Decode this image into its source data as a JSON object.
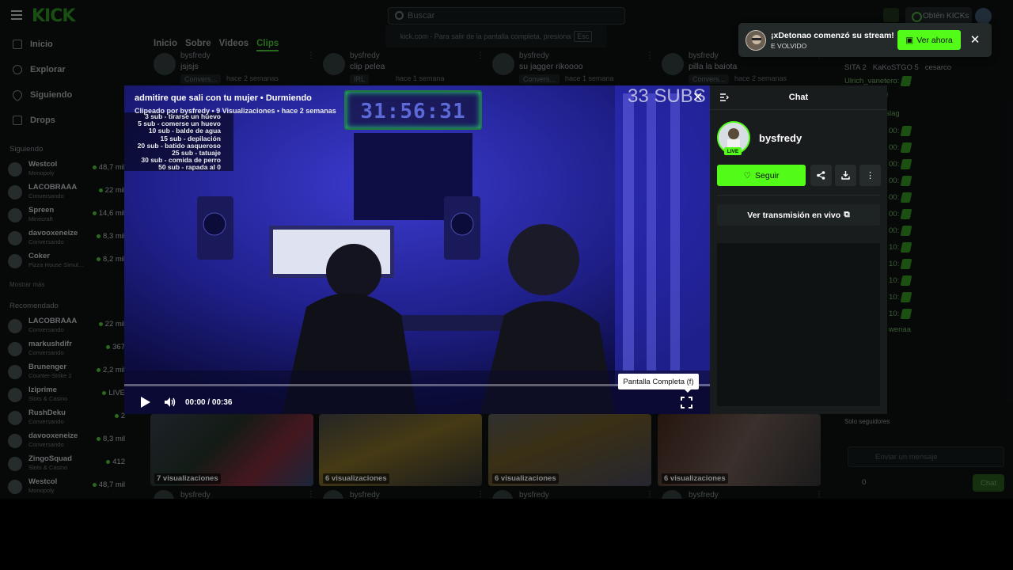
{
  "topbar": {
    "logo": "KICK",
    "search_placeholder": "Buscar",
    "fullscreen_hint": "kick.com - Para salir de la pantalla completa, presiona",
    "fullscreen_key": "Esc",
    "get_kicks": "Obtén KICKs"
  },
  "sidebar": {
    "nav": [
      {
        "label": "Inicio",
        "icon": "home-icon"
      },
      {
        "label": "Explorar",
        "icon": "compass-icon"
      },
      {
        "label": "Siguiendo",
        "icon": "heart-icon"
      },
      {
        "label": "Drops",
        "icon": "drops-icon"
      }
    ],
    "following_heading": "Siguiendo",
    "following": [
      {
        "name": "Westcol",
        "category": "Monopoly",
        "viewers": "48,7 mil"
      },
      {
        "name": "LACOBRAAA",
        "category": "Conversando",
        "viewers": "22 mil"
      },
      {
        "name": "Spreen",
        "category": "Minecraft",
        "viewers": "14,6 mil"
      },
      {
        "name": "davooxeneize",
        "category": "Conversando",
        "viewers": "8,3 mil"
      },
      {
        "name": "Coker",
        "category": "Pizza House Simul...",
        "viewers": "8,2 mil"
      }
    ],
    "show_more": "Mostrar más",
    "recommended_heading": "Recomendado",
    "recommended": [
      {
        "name": "LACOBRAAA",
        "category": "Conversando",
        "viewers": "22 mil"
      },
      {
        "name": "markushdifr",
        "category": "Conversando",
        "viewers": "367"
      },
      {
        "name": "Brunenger",
        "category": "Counter-Strike 2",
        "viewers": "2,2 mil"
      },
      {
        "name": "Iziprime",
        "category": "Slots & Casino",
        "viewers": "LIVE"
      },
      {
        "name": "RushDeku",
        "category": "Conversando",
        "viewers": "2"
      },
      {
        "name": "davooxeneize",
        "category": "Conversando",
        "viewers": "8,3 mil"
      },
      {
        "name": "ZingoSquad",
        "category": "Slots & Casino",
        "viewers": "412"
      },
      {
        "name": "Westcol",
        "category": "Monopoly",
        "viewers": "48,7 mil"
      }
    ]
  },
  "main": {
    "tabs": [
      "Inicio",
      "Sobre",
      "Videos",
      "Clips"
    ],
    "top_clips": [
      {
        "name": "bysfredy",
        "title": "jsjsjs",
        "tag": "Convers...",
        "ago": "hace 2 semanas"
      },
      {
        "name": "bysfredy",
        "title": "clip pelea",
        "tag": "IRL",
        "ago": "hace 1 semana"
      },
      {
        "name": "bysfredy",
        "title": "su jagger rikoooo",
        "tag": "Convers...",
        "ago": "hace 1 semana"
      },
      {
        "name": "bysfredy",
        "title": "pilla la baiota",
        "tag": "Convers...",
        "ago": "hace 2 semanas"
      }
    ],
    "bottom_clips": [
      {
        "views": "7 visualizaciones",
        "name": "bysfredy"
      },
      {
        "views": "6 visualizaciones",
        "name": "bysfredy"
      },
      {
        "views": "6 visualizaciones",
        "name": "bysfredy"
      },
      {
        "views": "6 visualizaciones",
        "name": "bysfredy"
      }
    ]
  },
  "bgchat": {
    "top_row": [
      "SITA 2",
      "KaKoSTGO 5",
      "cesarco"
    ],
    "rows": [
      "Ulrich_vanetero:",
      "vanetero:",
      "vanetero: byslag",
      "00:",
      "00:",
      "00:",
      "00:",
      "00:",
      "00:",
      "00:",
      "10:",
      "10:",
      "10:",
      "10:",
      "10:",
      "wenaa"
    ],
    "followers_only": "Solo seguidores",
    "input_placeholder": "Enviar un mensaje",
    "kicks": "0",
    "chat_button": "Chat"
  },
  "player": {
    "title": "admitire que sali con tu mujer • Durmiendo",
    "subtitle": "Clipeado por bysfredy • 9 Visualizaciones • hace 2 semanas",
    "subs_goals": [
      "3 sub - tirarse un huevo",
      "5 sub - comerse un huevo",
      "10 sub - balde de agua",
      "15 sub - depilación",
      "20 sub - batido asqueroso",
      "25 sub - tatuaje",
      "30 sub - comida de perro",
      "50 sub - rapada al 0"
    ],
    "timer": "31:56:31",
    "subs_count": "33 SUBS",
    "time": "00:00 / 00:36",
    "progress": 0,
    "tooltip": "Pantalla Completa (f)"
  },
  "panel": {
    "title": "Chat",
    "channel": "bysfredy",
    "live": "LIVE",
    "follow": "Seguir",
    "watch_live": "Ver transmisión en vivo"
  },
  "notification": {
    "message": "¡xDetonao comenzó su stream!",
    "subtext": "E VOLVIDO",
    "watch": "Ver ahora"
  },
  "colors": {
    "accent": "#53fc18",
    "background": "#0b0e0f",
    "panel": "#181c1d"
  }
}
